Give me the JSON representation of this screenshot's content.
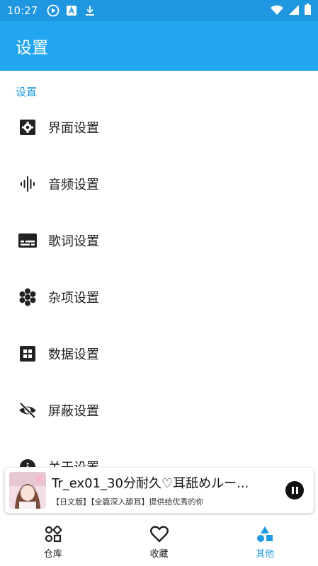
{
  "status_bar": {
    "time": "10:27",
    "icons": [
      "play-circle-icon",
      "text-a-icon",
      "download-icon",
      "wifi-icon",
      "signal-icon",
      "battery-icon"
    ]
  },
  "app_bar": {
    "title": "设置"
  },
  "section": {
    "header": "设置"
  },
  "settings": {
    "items": [
      {
        "label": "界面设置",
        "icon": "gear-icon"
      },
      {
        "label": "音频设置",
        "icon": "audio-waveform-icon"
      },
      {
        "label": "歌词设置",
        "icon": "subtitles-icon"
      },
      {
        "label": "杂项设置",
        "icon": "workspaces-icon"
      },
      {
        "label": "数据设置",
        "icon": "grid-icon"
      },
      {
        "label": "屏蔽设置",
        "icon": "visibility-off-icon"
      },
      {
        "label": "关于设置",
        "icon": "info-icon"
      }
    ]
  },
  "player": {
    "title": "Tr_ex01_30分耐久♡耳舐めルー...",
    "subtitle": "【日文版】【全篇深入舔耳】提供给优秀的你",
    "state": "playing"
  },
  "bottom_nav": {
    "items": [
      {
        "label": "仓库",
        "icon": "category-icon",
        "active": false
      },
      {
        "label": "收藏",
        "icon": "heart-outline-icon",
        "active": false
      },
      {
        "label": "其他",
        "icon": "shapes-icon",
        "active": true
      }
    ]
  },
  "colors": {
    "status_bar": "#1e96e0",
    "app_bar": "#23a6f0",
    "accent": "#1e9be0",
    "text": "#222222"
  }
}
